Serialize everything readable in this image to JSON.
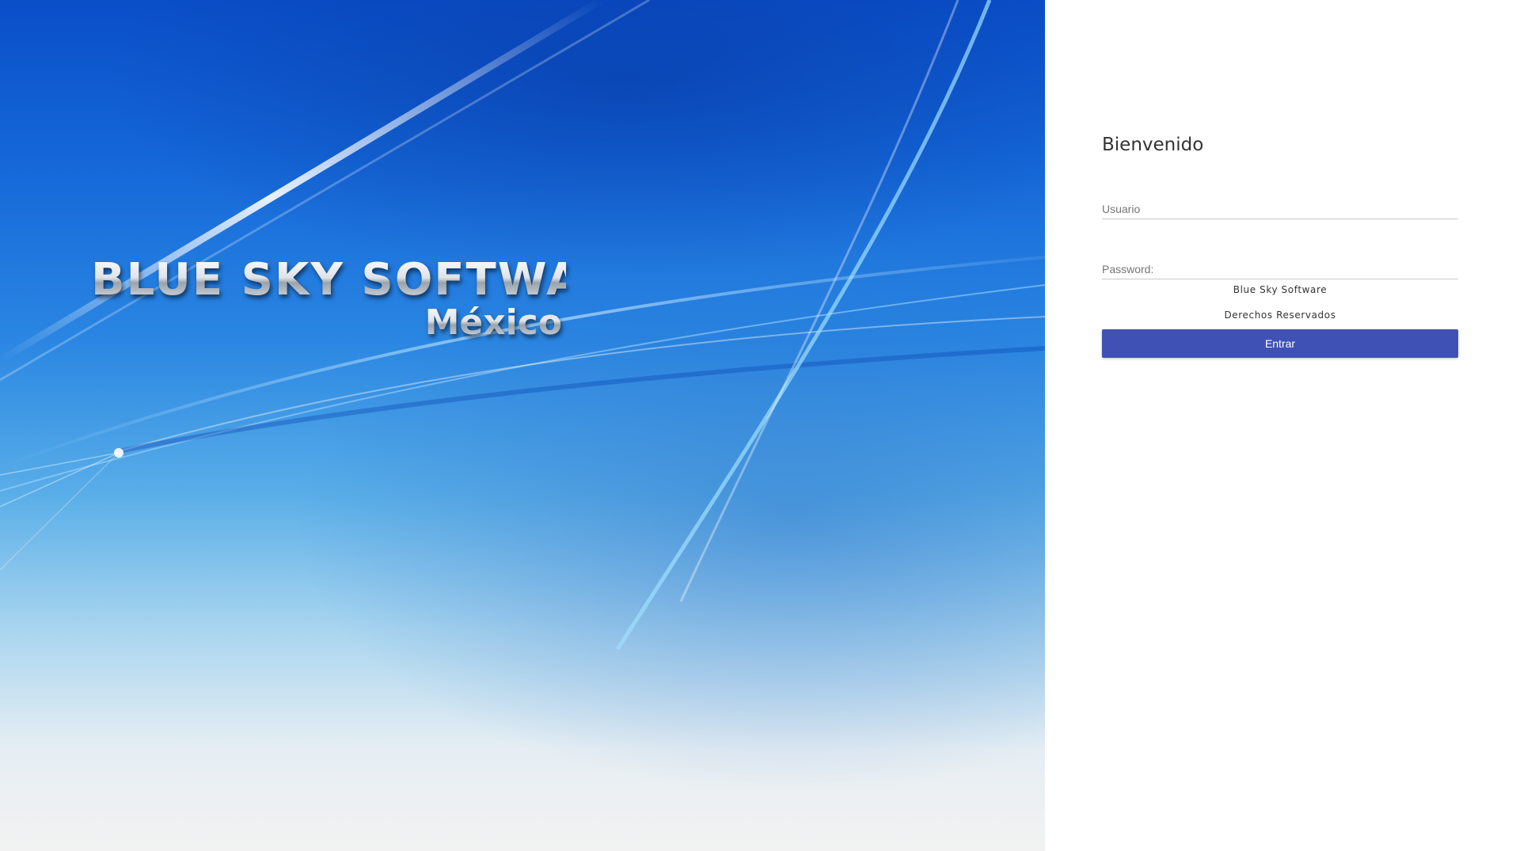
{
  "brand": {
    "title": "BLUE SKY SOFTWARE",
    "subtitle": "México"
  },
  "login": {
    "welcome": "Bienvenido",
    "username_label": "Usuario",
    "username_value": "",
    "password_label": "Password:",
    "password_value": "",
    "company": "Blue Sky Software",
    "rights": "Derechos Reservados",
    "submit_label": "Entrar"
  },
  "colors": {
    "accent": "#3f51b5",
    "hero_blue": "#1466d8",
    "panel_bg": "#ffffff"
  }
}
